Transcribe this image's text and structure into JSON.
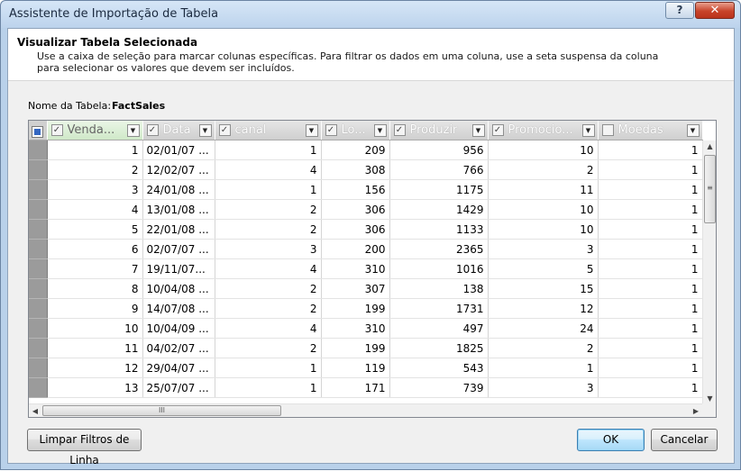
{
  "window": {
    "title": "Assistente de Importação de Tabela",
    "help_label": "?",
    "close_label": "✕"
  },
  "header": {
    "title": "Visualizar Tabela Selecionada",
    "description": "Use a caixa de seleção para marcar colunas específicas. Para filtrar os dados em uma coluna, use a seta suspensa da coluna para selecionar os valores que devem ser incluídos."
  },
  "table_name": {
    "label": "Nome da Tabela:",
    "value": "FactSales"
  },
  "grid": {
    "columns": [
      {
        "label": "Venda...",
        "checked": true
      },
      {
        "label": "Data",
        "checked": true
      },
      {
        "label": "canal",
        "checked": true
      },
      {
        "label": "Lo...",
        "checked": true
      },
      {
        "label": "Produzir",
        "checked": true
      },
      {
        "label": "Promocio...",
        "checked": true
      },
      {
        "label": "Moedas",
        "checked": false
      }
    ],
    "rows": [
      [
        "1",
        "02/01/07 ...",
        "1",
        "209",
        "956",
        "10",
        "1"
      ],
      [
        "2",
        "12/02/07 ...",
        "4",
        "308",
        "766",
        "2",
        "1"
      ],
      [
        "3",
        "24/01/08 ...",
        "1",
        "156",
        "1175",
        "11",
        "1"
      ],
      [
        "4",
        "13/01/08 ...",
        "2",
        "306",
        "1429",
        "10",
        "1"
      ],
      [
        "5",
        "22/01/08 ...",
        "2",
        "306",
        "1133",
        "10",
        "1"
      ],
      [
        "6",
        "02/07/07 ...",
        "3",
        "200",
        "2365",
        "3",
        "1"
      ],
      [
        "7",
        "19/11/07...",
        "4",
        "310",
        "1016",
        "5",
        "1"
      ],
      [
        "8",
        "10/04/08 ...",
        "2",
        "307",
        "138",
        "15",
        "1"
      ],
      [
        "9",
        "14/07/08 ...",
        "2",
        "199",
        "1731",
        "12",
        "1"
      ],
      [
        "10",
        "10/04/09 ...",
        "4",
        "310",
        "497",
        "24",
        "1"
      ],
      [
        "11",
        "04/02/07 ...",
        "2",
        "199",
        "1825",
        "2",
        "1"
      ],
      [
        "12",
        "29/04/07 ...",
        "1",
        "119",
        "543",
        "1",
        "1"
      ],
      [
        "13",
        "25/07/07 ...",
        "1",
        "171",
        "739",
        "3",
        "1"
      ]
    ]
  },
  "buttons": {
    "clear_filters": "Limpar Filtros de Linha",
    "ok": "OK",
    "cancel": "Cancelar"
  },
  "icons": {
    "check": "✓",
    "dropdown": "▼",
    "grip": "≡",
    "grip_h": "III"
  }
}
